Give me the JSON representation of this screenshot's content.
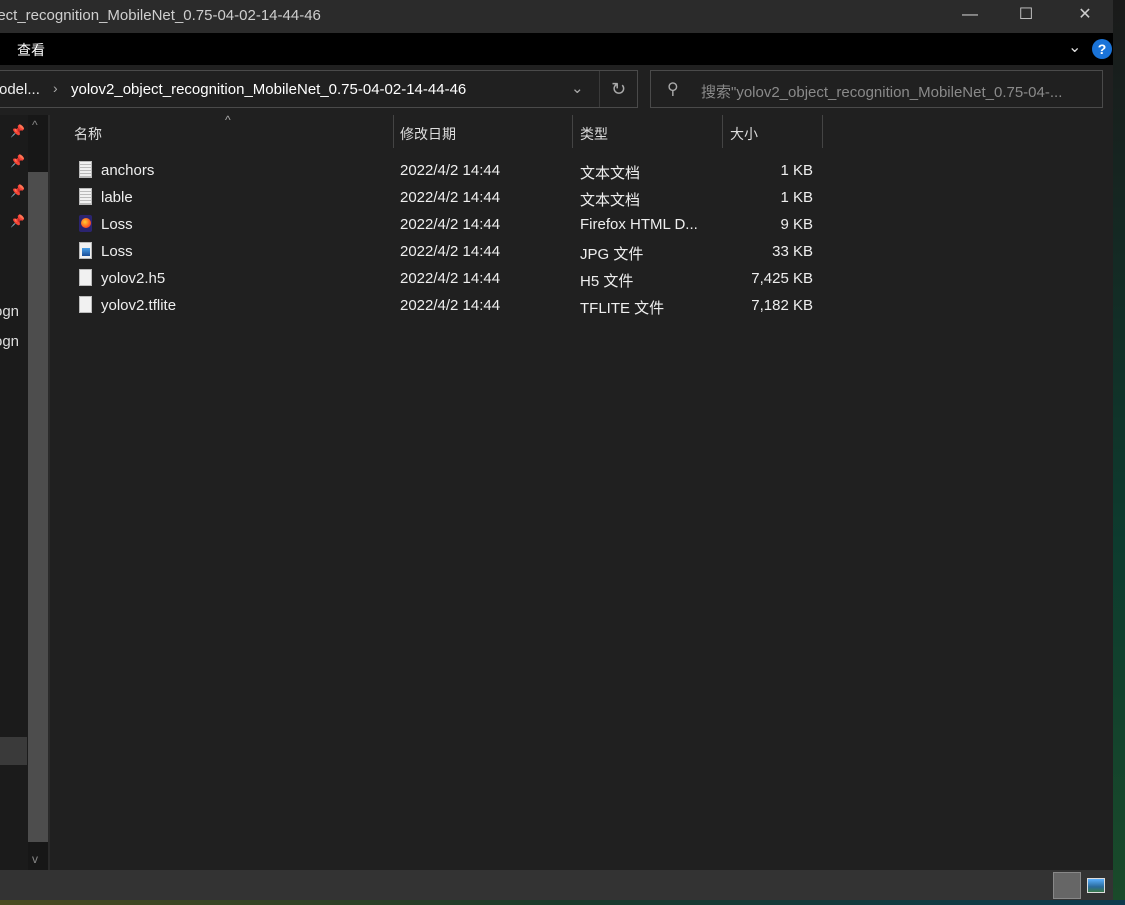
{
  "window": {
    "title": "ject_recognition_MobileNet_0.75-04-02-14-44-46",
    "minimize": "—",
    "maximize": "☐",
    "close": "✕"
  },
  "ribbon": {
    "tab_view": "查看",
    "expand_icon": "chevron-down",
    "help": "?"
  },
  "address": {
    "parent": "odel...",
    "separator": "›",
    "current": "yolov2_object_recognition_MobileNet_0.75-04-02-14-44-46",
    "dropdown": "⌄",
    "refresh": "↻"
  },
  "search": {
    "icon": "⚲",
    "placeholder": "搜索\"yolov2_object_recognition_MobileNet_0.75-04-..."
  },
  "nav": {
    "items": [
      "ogn",
      "ogn"
    ]
  },
  "columns": {
    "name": "名称",
    "date": "修改日期",
    "type": "类型",
    "size": "大小"
  },
  "files": [
    {
      "name": "anchors",
      "date": "2022/4/2 14:44",
      "type": "文本文档",
      "size": "1 KB",
      "icon": "txt"
    },
    {
      "name": "lable",
      "date": "2022/4/2 14:44",
      "type": "文本文档",
      "size": "1 KB",
      "icon": "txt"
    },
    {
      "name": "Loss",
      "date": "2022/4/2 14:44",
      "type": "Firefox HTML D...",
      "size": "9 KB",
      "icon": "ff"
    },
    {
      "name": "Loss",
      "date": "2022/4/2 14:44",
      "type": "JPG 文件",
      "size": "33 KB",
      "icon": "jpg"
    },
    {
      "name": "yolov2.h5",
      "date": "2022/4/2 14:44",
      "type": "H5 文件",
      "size": "7,425 KB",
      "icon": "file"
    },
    {
      "name": "yolov2.tflite",
      "date": "2022/4/2 14:44",
      "type": "TFLITE 文件",
      "size": "7,182 KB",
      "icon": "file"
    }
  ],
  "colors": {
    "accent": "#1a73d8",
    "background": "#202020"
  }
}
